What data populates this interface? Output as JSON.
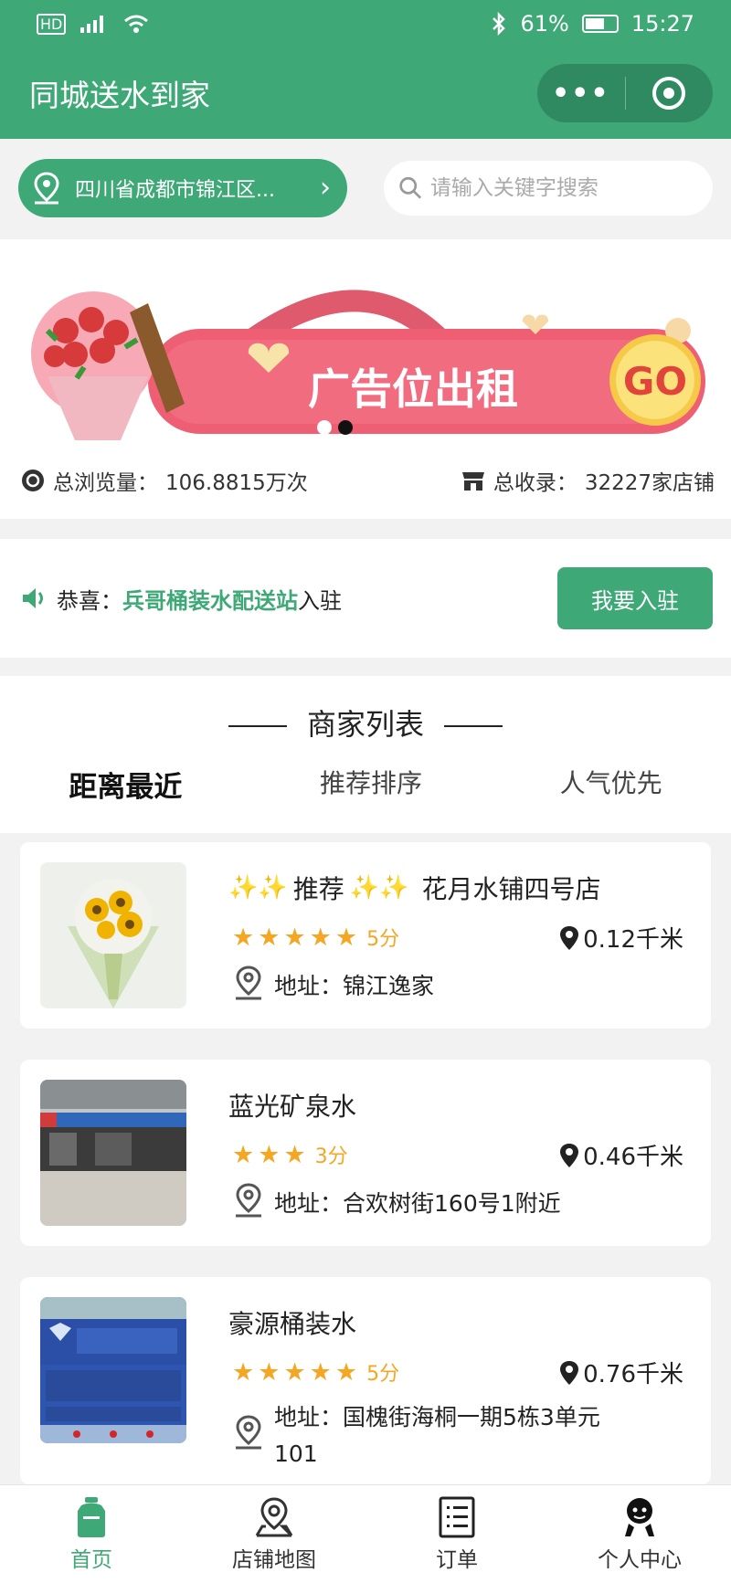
{
  "status_bar": {
    "left_icons": [
      "hd-icon",
      "signal-icon",
      "wifi-icon"
    ],
    "battery": "61%",
    "battery_level": 0.61,
    "time": "15:27"
  },
  "header": {
    "title": "同城送水到家"
  },
  "search": {
    "location": "四川省成都市锦江区...",
    "placeholder": "请输入关键字搜索"
  },
  "banner": {
    "text": "广告位出租",
    "go": "GO",
    "active_dot": 1
  },
  "stats": {
    "views_label": "总浏览量：",
    "views_value": "106.8815万次",
    "shops_label": "总收录：",
    "shops_value": "32227家店铺"
  },
  "announcement": {
    "prefix": "恭喜：",
    "shop": "兵哥桶装水配送站",
    "suffix": "入驻",
    "join_button": "我要入驻"
  },
  "list": {
    "title": "商家列表",
    "sort_tabs": [
      "距离最近",
      "推荐排序",
      "人气优先"
    ],
    "active_sort": 0,
    "shops": [
      {
        "badge": "推荐",
        "name": "花月水铺四号店",
        "stars": 5,
        "score": "5分",
        "distance": "0.12千米",
        "address_label": "地址：",
        "address": "锦江逸家"
      },
      {
        "badge": "",
        "name": "蓝光矿泉水",
        "stars": 3,
        "score": "3分",
        "distance": "0.46千米",
        "address_label": "地址：",
        "address": "合欢树街160号1附近"
      },
      {
        "badge": "",
        "name": "豪源桶装水",
        "stars": 5,
        "score": "5分",
        "distance": "0.76千米",
        "address_label": "地址：",
        "address": "国槐街海桐一期5栋3单元101"
      }
    ]
  },
  "tabbar": {
    "items": [
      "首页",
      "店铺地图",
      "订单",
      "个人中心"
    ],
    "active": 0
  },
  "colors": {
    "brand": "#3fa877",
    "star": "#f5a623"
  }
}
